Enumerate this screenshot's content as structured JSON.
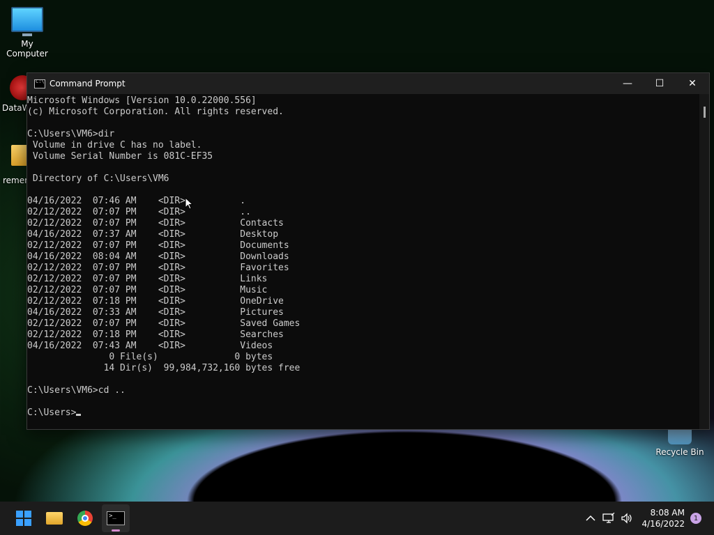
{
  "desktop": {
    "icons": [
      {
        "label": "My Computer"
      },
      {
        "label": "DataW"
      },
      {
        "label": "remem"
      },
      {
        "label": "Recycle Bin"
      }
    ]
  },
  "window": {
    "title": "Command Prompt",
    "controls": {
      "minimize": "—",
      "maximize": "☐",
      "close": "✕"
    }
  },
  "terminal": {
    "lines": [
      "Microsoft Windows [Version 10.0.22000.556]",
      "(c) Microsoft Corporation. All rights reserved.",
      "",
      "C:\\Users\\VM6>dir",
      " Volume in drive C has no label.",
      " Volume Serial Number is 081C-EF35",
      "",
      " Directory of C:\\Users\\VM6",
      "",
      "04/16/2022  07:46 AM    <DIR>          .",
      "02/12/2022  07:07 PM    <DIR>          ..",
      "02/12/2022  07:07 PM    <DIR>          Contacts",
      "04/16/2022  07:37 AM    <DIR>          Desktop",
      "02/12/2022  07:07 PM    <DIR>          Documents",
      "04/16/2022  08:04 AM    <DIR>          Downloads",
      "02/12/2022  07:07 PM    <DIR>          Favorites",
      "02/12/2022  07:07 PM    <DIR>          Links",
      "02/12/2022  07:07 PM    <DIR>          Music",
      "02/12/2022  07:18 PM    <DIR>          OneDrive",
      "04/16/2022  07:33 AM    <DIR>          Pictures",
      "02/12/2022  07:07 PM    <DIR>          Saved Games",
      "02/12/2022  07:18 PM    <DIR>          Searches",
      "04/16/2022  07:43 AM    <DIR>          Videos",
      "               0 File(s)              0 bytes",
      "              14 Dir(s)  99,984,732,160 bytes free",
      "",
      "C:\\Users\\VM6>cd ..",
      ""
    ],
    "prompt": "C:\\Users>"
  },
  "taskbar": {
    "apps": [
      {
        "icon": "windows-start-icon"
      },
      {
        "icon": "file-explorer-icon"
      },
      {
        "icon": "chrome-icon"
      },
      {
        "icon": "command-prompt-icon",
        "active": true
      }
    ],
    "tray": {
      "time": "8:08 AM",
      "date": "4/16/2022",
      "notification_count": "1"
    }
  }
}
